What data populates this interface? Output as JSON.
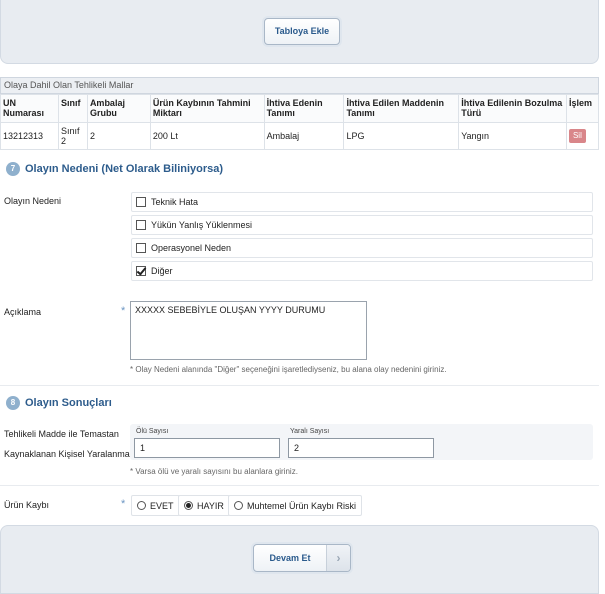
{
  "toolbar": {
    "add_table_label": "Tabloya Ekle"
  },
  "goods_table": {
    "caption": "Olaya Dahil Olan Tehlikeli Mallar",
    "headers": [
      "UN Numarası",
      "Sınıf",
      "Ambalaj Grubu",
      "Ürün Kaybının Tahmini Miktarı",
      "İhtiva Edenin Tanımı",
      "İhtiva Edilen Maddenin Tanımı",
      "İhtiva Edilenin Bozulma Türü",
      "İşlem"
    ],
    "rows": [
      {
        "un": "13212313",
        "class": "Sınıf 2",
        "pack_group": "2",
        "amount": "200 Lt",
        "container": "Ambalaj",
        "substance": "LPG",
        "damage": "Yangın",
        "action": "Sil"
      }
    ]
  },
  "section7": {
    "number": "7",
    "title": "Olayın Nedeni (Net Olarak Biliniyorsa)",
    "cause_label": "Olayın Nedeni",
    "options": [
      {
        "label": "Teknik Hata",
        "checked": false
      },
      {
        "label": "Yükün Yanlış Yüklenmesi",
        "checked": false
      },
      {
        "label": "Operasyonel Neden",
        "checked": false
      },
      {
        "label": "Diğer",
        "checked": true
      }
    ],
    "desc_label": "Açıklama",
    "desc_value": "XXXXX SEBEBİYLE OLUŞAN YYYY DURUMU",
    "desc_hint": "* Olay Nedeni alanında \"Diğer\" seçeneğini işaretlediyseniz, bu alana olay nedenini giriniz."
  },
  "section8": {
    "number": "8",
    "title": "Olayın Sonuçları",
    "casualty_label_line1": "Tehlikeli Madde ile Temastan",
    "casualty_label_line2": "Kaynaklanan Kişisel Yaralanma",
    "dead_label": "Ölü Sayısı",
    "dead_value": "1",
    "injured_label": "Yaralı Sayısı",
    "injured_value": "2",
    "casualty_hint": "* Varsa ölü ve yaralı sayısını bu alanlara giriniz.",
    "loss_label": "Ürün Kaybı",
    "loss_options": [
      {
        "label": "EVET",
        "selected": false
      },
      {
        "label": "HAYIR",
        "selected": true
      },
      {
        "label": "Muhtemel Ürün Kaybı Riski",
        "selected": false
      }
    ]
  },
  "footer": {
    "continue_label": "Devam Et",
    "arrow_glyph": "›"
  }
}
